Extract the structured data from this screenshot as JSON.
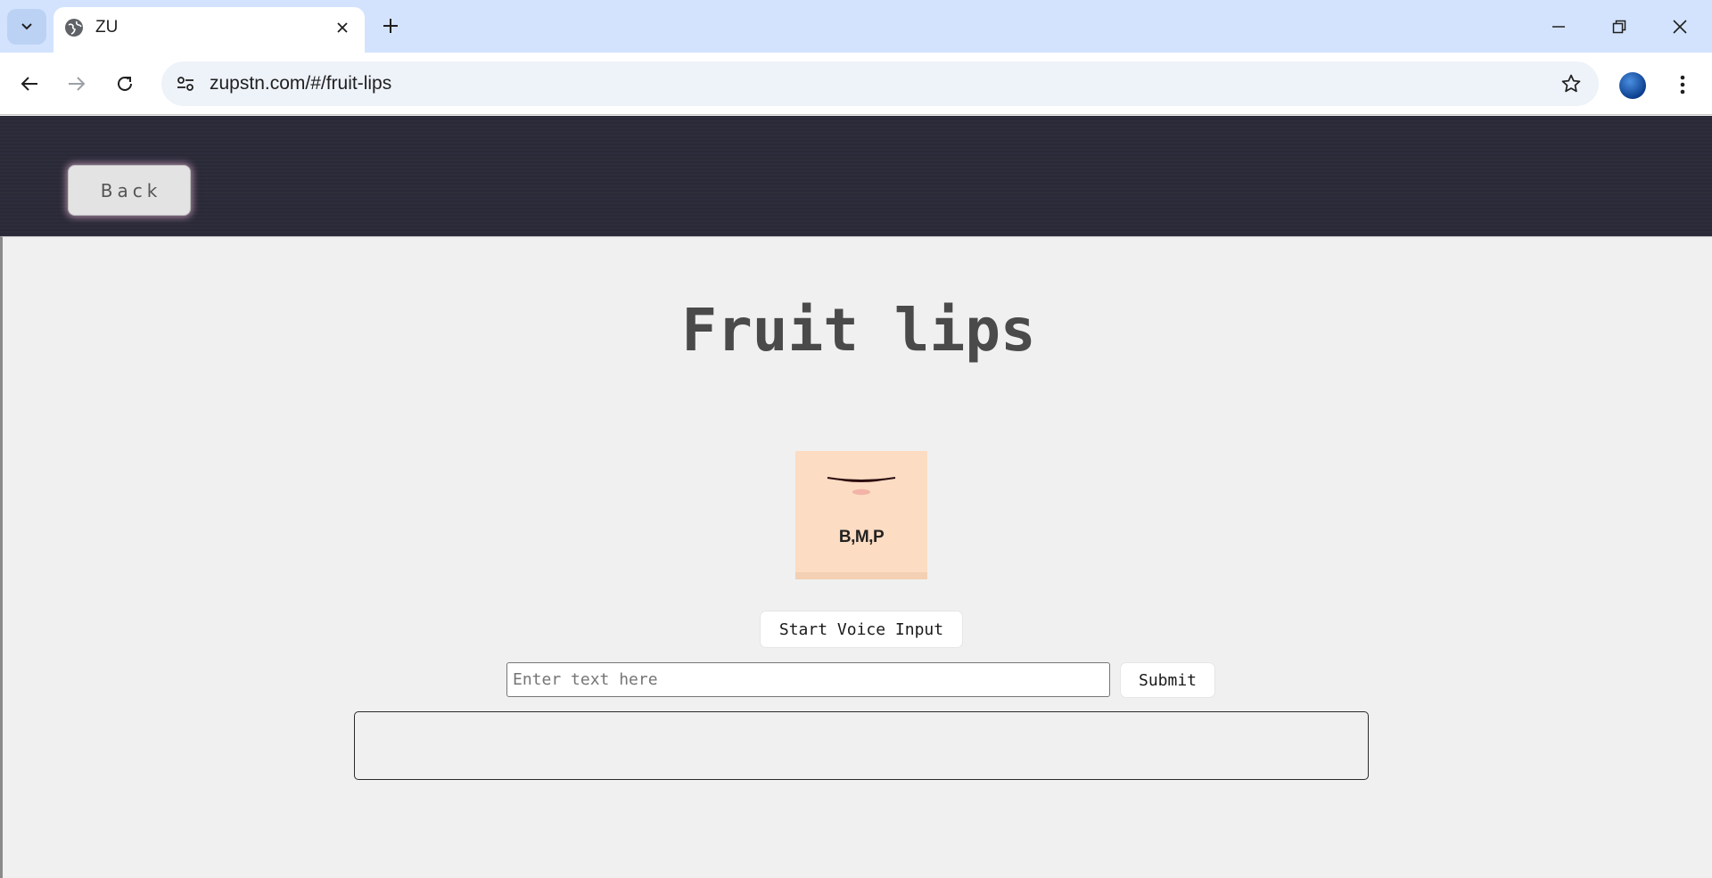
{
  "browser": {
    "tab": {
      "title": "ZU"
    },
    "address_bar": {
      "url": "zupstn.com/#/fruit-lips"
    }
  },
  "page": {
    "header": {
      "back_label": "Back"
    },
    "title": "Fruit lips",
    "lip_card": {
      "phoneme_label": "B,M,P"
    },
    "voice_button_label": "Start Voice Input",
    "text_input": {
      "placeholder": "Enter text here",
      "value": ""
    },
    "submit_label": "Submit",
    "output_text": ""
  },
  "colors": {
    "header_bg": "#2e2d3c",
    "page_bg": "#f0f0f0",
    "title": "#4a4a4a",
    "lip_card_bg": "#fcdcc2",
    "lip_line": "#3a1214",
    "tabbar_bg": "#d3e3fd"
  }
}
